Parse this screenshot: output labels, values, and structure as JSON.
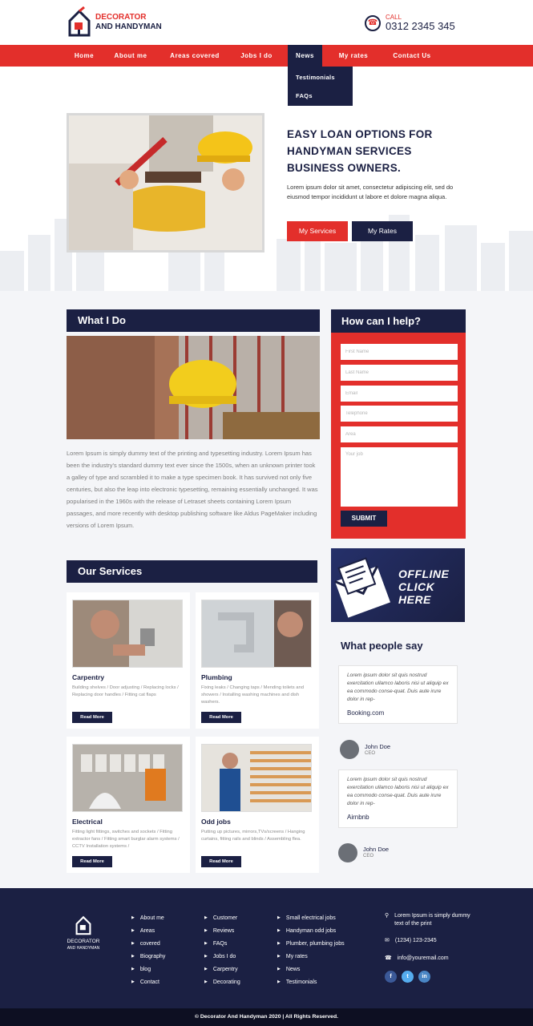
{
  "brand": {
    "line1": "DECORATOR",
    "line2": "AND HANDYMAN",
    "accent": "#e32f2b",
    "navy": "#1b2043"
  },
  "call": {
    "label": "CALL",
    "number": "0312 2345 345",
    "icon": "phone-icon"
  },
  "nav": {
    "items": [
      "Home",
      "About me",
      "Areas covered",
      "Jobs I do",
      "News",
      "My rates",
      "Contact Us"
    ],
    "active": "News",
    "dropdown": [
      "Testimonials",
      "FAQs"
    ]
  },
  "hero": {
    "title": "EASY LOAN OPTIONS FOR HANDYMAN SERVICES BUSINESS OWNERS.",
    "text": "Lorem ipsum dolor sit amet, consectetur adipiscing elit, sed do eiusmod tempor incididunt ut labore et dolore magna aliqua.",
    "btn_services": "My Services",
    "btn_rates": "My Rates"
  },
  "what": {
    "title": "What I Do",
    "paragraph": "Lorem Ipsum is simply dummy text of the printing and typesetting industry. Lorem Ipsum has been the industry's standard dummy text ever since the 1500s, when an unknown printer took a galley of type and scrambled it to make a type specimen book. It has survived not only five centuries, but also the leap into electronic typesetting, remaining essentially unchanged. It was popularised in the 1960s with the release of Letraset sheets containing Lorem Ipsum passages, and more recently with desktop publishing software like Aldus PageMaker including versions of Lorem Ipsum."
  },
  "form": {
    "title": "How can I help?",
    "first_name": "First Name",
    "last_name": "Last Name",
    "email": "Email",
    "telephone": "Telephone",
    "area": "Area",
    "job": "Your job",
    "submit": "SUBMIT"
  },
  "offline": {
    "line1": "OFFLINE",
    "line2": "CLICK",
    "line3": "HERE"
  },
  "services": {
    "title": "Our Services",
    "read_more": "Read More",
    "items": [
      {
        "title": "Carpentry",
        "desc": "Building shelves / Door adjusting / Replacing locks / Replacing door handles / Fitting cat flaps"
      },
      {
        "title": "Plumbing",
        "desc": "Fixing leaks / Changing taps / Mending toilets and showers / Installing washing machines and dish washers."
      },
      {
        "title": "Electrical",
        "desc": "Fitting light fittings, switches and sockets / Fitting extractor fans / Fitting smart burglar alarm systems / CCTV Installation systems /"
      },
      {
        "title": "Odd jobs",
        "desc": "Putting up pictures, mirrors,TVs/screens / Hanging curtains, fitting rails and blinds / Assembling flea."
      }
    ]
  },
  "testimonials": {
    "title": "What people say",
    "items": [
      {
        "quote": "Lorem ipsum dolor sit quis nostrud exercitation ullamco laboris nisi ut aliquip ex ea commodo conse-quat. Duis aute irure dolor in rep-",
        "source": "Booking.com",
        "name": "John Doe",
        "role": "CEO"
      },
      {
        "quote": "Lorem ipsum dolor sit quis nostrud exercitation ullamco laboris nisi ut aliquip ex ea commodo conse-quat. Duis aute irure dolor in rep-",
        "source": "Airnbnb",
        "name": "John Doe",
        "role": "CEO"
      }
    ]
  },
  "footer": {
    "logo_line1": "DECORATOR",
    "logo_line2": "AND HANDYMAN",
    "col1": [
      "About me",
      "Areas",
      "covered",
      "Biography",
      "blog",
      "Contact"
    ],
    "col2": [
      "Customer",
      "Reviews",
      "FAQs",
      "Jobs I do",
      "Carpentry",
      "Decorating"
    ],
    "col3": [
      "Small electrical jobs",
      "Handyman odd jobs",
      "Plumber, plumbing jobs",
      "My rates",
      "News",
      "Testimonials"
    ],
    "address": "Lorem Ipsum is simply dummy text of the print",
    "phone": "(1234) 123-2345",
    "email": "info@youremail.com",
    "social": [
      "f",
      "t",
      "in"
    ],
    "copyright": "© Decorator And Handyman 2020 | All Rights Reserved."
  }
}
